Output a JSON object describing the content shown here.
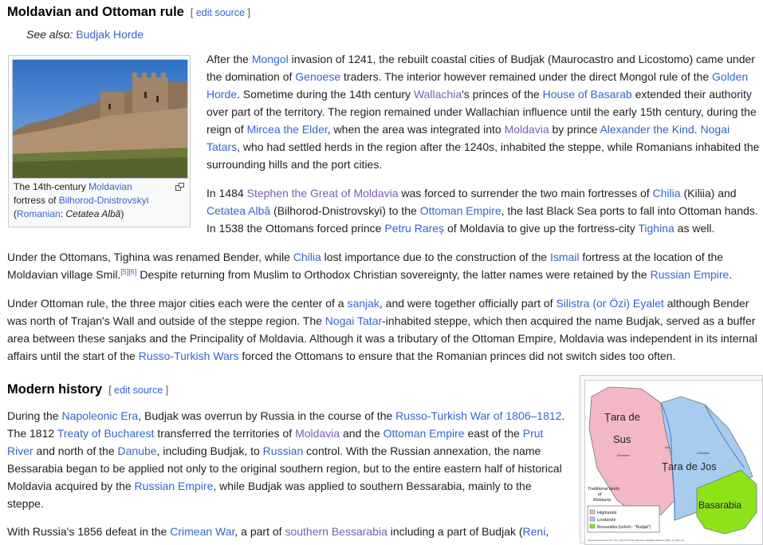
{
  "section1": {
    "heading": "Moldavian and Ottoman rule",
    "edit": {
      "open": "[",
      "link": "edit source",
      "close": "]"
    },
    "see_also": {
      "prefix": "See also:",
      "link": "Budjak Horde"
    }
  },
  "fortress_figure": {
    "caption": {
      "t1": "The 14th-century ",
      "l1": "Moldavian",
      "t2": " fortress of ",
      "l2": "Bilhorod-Dnistrovskyi",
      "t3": " (",
      "l3": "Romanian",
      "t4": ": ",
      "t5": "Cetatea Albă",
      "t6": ")"
    },
    "icon": "enlarge-icon"
  },
  "p1": {
    "t1": "After the ",
    "l1": "Mongol",
    "t2": " invasion of 1241, the rebuilt coastal cities of Budjak (Maurocastro and Licostomo) came under the domination of ",
    "l2": "Genoese",
    "t3": " traders. The interior however remained under the direct Mongol rule of the ",
    "l3": "Golden Horde",
    "t4": ". Sometime during the 14th century ",
    "l4": "Wallachia",
    "t5": "'s princes of the ",
    "l5": "House of Basarab",
    "t6": " extended their authority over part of the territory. The region remained under Wallachian influence until the early 15th century, during the reign of ",
    "l6": "Mircea the Elder",
    "t7": ", when the area was integrated into ",
    "l7": "Moldavia",
    "t8": " by prince ",
    "l8": "Alexander the Kind",
    "t9": ". ",
    "l9": "Nogai Tatars",
    "t10": ", who had settled herds in the region after the 1240s, inhabited the steppe, while Romanians inhabited the surrounding hills and the port cities."
  },
  "p2": {
    "t1": "In 1484 ",
    "l1": "Stephen the Great of Moldavia",
    "t2": " was forced to surrender the two main fortresses of ",
    "l2": "Chilia",
    "t3": " (Kiliia) and ",
    "l3": "Cetatea Albă",
    "t4": " (Bilhorod-Dnistrovskyi) to the ",
    "l4": "Ottoman Empire",
    "t5": ", the last Black Sea ports to fall into Ottoman hands. In 1538 the Ottomans forced prince ",
    "l5": "Petru Rareș",
    "t6": " of Moldavia to give up the fortress-city ",
    "l6": "Tighina",
    "t7": " as well."
  },
  "p3": {
    "t1": "Under the Ottomans, Tighina was renamed Bender, while ",
    "l1": "Chilia",
    "t2": " lost importance due to the construction of the ",
    "l2": "Ismail",
    "t3": " fortress at the location of the Moldavian village Smil.",
    "ref1": "[5]",
    "ref2": "[6]",
    "t4": " Despite returning from Muslim to Orthodox Christian sovereignty, the latter names were retained by the ",
    "l3": "Russian Empire",
    "t5": "."
  },
  "p4": {
    "t1": "Under Ottoman rule, the three major cities each were the center of a ",
    "l1": "sanjak",
    "t2": ", and were together officially part of ",
    "l2": "Silistra (or Özi) Eyalet",
    "t3": " although Bender was north of Trajan's Wall and outside of the steppe region. The ",
    "l3": "Nogai Tatar",
    "t4": "-inhabited steppe, which then acquired the name Budjak, served as a buffer area between these sanjaks and the Principality of Moldavia. Although it was a tributary of the Ottoman Empire, Moldavia was independent in its internal affairs until the start of the ",
    "l4": "Russo-Turkish Wars",
    "t5": " forced the Ottomans to ensure that the Romanian princes did not switch sides too often."
  },
  "section2": {
    "heading": "Modern history",
    "edit": {
      "open": "[",
      "link": "edit source",
      "close": "]"
    }
  },
  "p5": {
    "t1": "During the ",
    "l1": "Napoleonic Era",
    "t2": ", Budjak was overrun by Russia in the course of the ",
    "l2": "Russo-Turkish War of 1806–1812",
    "t3": ". The 1812 ",
    "l3": "Treaty of Bucharest",
    "t4": " transferred the territories of ",
    "l4": "Moldavia",
    "t5": " and the ",
    "l5": "Ottoman Empire",
    "t6": " east of the ",
    "l6": "Prut River",
    "t7": " and north of the ",
    "l7": "Danube",
    "t8": ", including Budjak, to ",
    "l8": "Russian",
    "t9": " control. With the Russian annexation, the name Bessarabia began to be applied not only to the original southern region, but to the entire eastern half of historical Moldavia acquired by the ",
    "l9": "Russian Empire",
    "t10": ", while Budjak was applied to southern Bessarabia, mainly to the steppe."
  },
  "p6": {
    "t1": "With Russia's 1856 defeat in the ",
    "l1": "Crimean War",
    "t2": ", a part of ",
    "l2": "southern Bessarabia",
    "t3": " including a part of Budjak (",
    "l3": "Reni",
    "t4": ","
  },
  "map": {
    "region1": "Țara de Sus",
    "region1a": "Țara de",
    "region1b": "Sus",
    "region2": "Țara de Jos",
    "region3": "Basarabia",
    "legend_title1": "Traditional lands",
    "legend_title2": "of",
    "legend_title3": "Moldavia",
    "legend": [
      "Highlands",
      "Lowlands",
      "Bessarabia (turkish : \"Budjak\")"
    ],
    "colors": {
      "highlands": "#f2b8c6",
      "lowlands": "#a8ccee",
      "bessarabia": "#8ce31a"
    },
    "towns": [
      "Suceava",
      "Iași",
      "Chișinău"
    ],
    "credit": "Sava Demetrius Cantemir's map - https://commons.wikimedia.org/wiki/File:Moldova_Walter_ref_Wars.png"
  }
}
